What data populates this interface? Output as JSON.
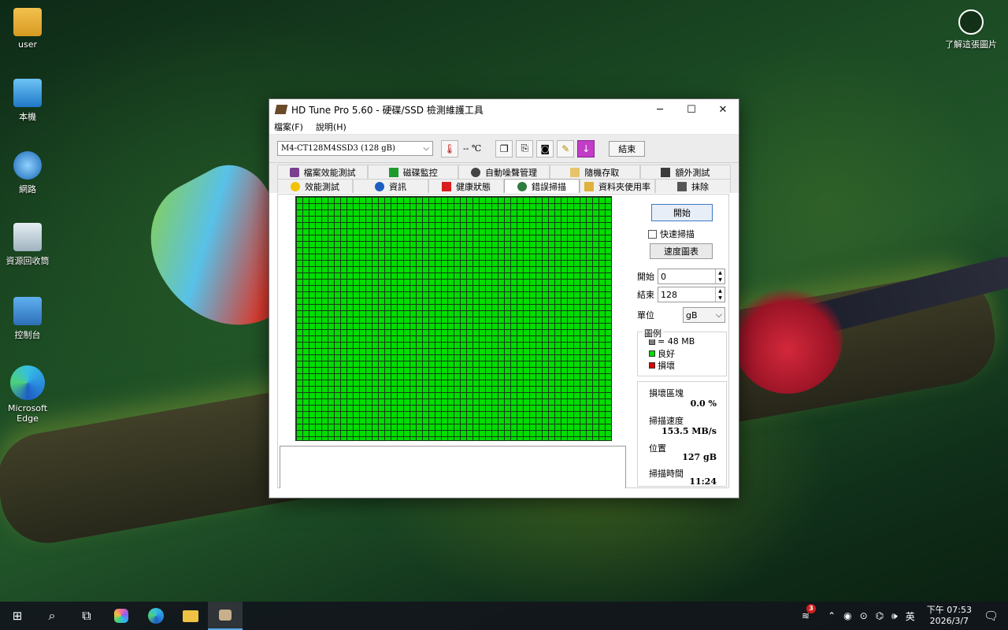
{
  "desktop": {
    "icons": [
      {
        "label": "user"
      },
      {
        "label": "本機"
      },
      {
        "label": "網路"
      },
      {
        "label": "資源回收筒"
      },
      {
        "label": "控制台"
      },
      {
        "label": "Microsoft Edge"
      }
    ],
    "learn_label": "了解這張圖片"
  },
  "window": {
    "title": "HD Tune Pro 5.60 - 硬碟/SSD 檢測維護工具",
    "menu": [
      "檔案(F)",
      "說明(H)"
    ],
    "drive": "M4-CT128M4SSD3 (128 gB)",
    "temperature": "-- ℃",
    "exit_label": "結束",
    "tabs_row1": [
      "檔案效能測試",
      "磁碟監控",
      "自動噪聲管理",
      "隨機存取",
      "額外測試"
    ],
    "tabs_row2": [
      "效能測試",
      "資訊",
      "健康狀態",
      "錯誤掃描",
      "資料夾使用率",
      "抹除"
    ],
    "active_tab": "錯誤掃描",
    "scan": {
      "start_label": "開始",
      "quick_scan_label": "快速掃描",
      "quick_scan_checked": false,
      "speed_map_label": "速度圖表",
      "start_field_label": "開始",
      "start_value": "0",
      "end_field_label": "結束",
      "end_value": "128",
      "unit_label": "單位",
      "unit_value": "gB",
      "legend_title": "圖例",
      "legend": [
        {
          "label": "= 48 MB",
          "color": "#808080"
        },
        {
          "label": "良好",
          "color": "#00dd00"
        },
        {
          "label": "損壞",
          "color": "#dd0000"
        }
      ],
      "damaged_label": "損壞區塊",
      "damaged_value": "0.0 %",
      "speed_label": "掃描速度",
      "speed_value": "153.5 MB/s",
      "position_label": "位置",
      "position_value": "127 gB",
      "time_label": "掃描時間",
      "time_value": "11:24"
    }
  },
  "taskbar": {
    "ime": "英",
    "time": "下午 07:53",
    "date": "2026/3/7",
    "notification_count": "3"
  }
}
